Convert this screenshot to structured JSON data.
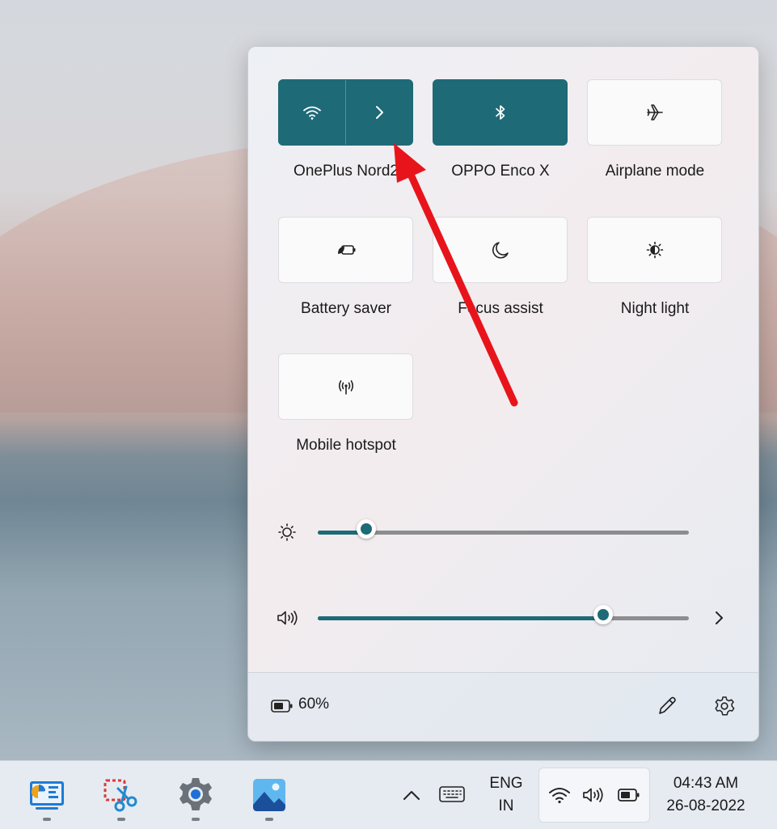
{
  "quick_settings": {
    "tiles": [
      {
        "label": "OnePlus Nord2",
        "icon": "wifi-icon",
        "state": "on",
        "has_expand": true
      },
      {
        "label": "OPPO Enco X",
        "icon": "bluetooth-icon",
        "state": "on"
      },
      {
        "label": "Airplane mode",
        "icon": "airplane-icon",
        "state": "off"
      },
      {
        "label": "Battery saver",
        "icon": "battery-saver-icon",
        "state": "off"
      },
      {
        "label": "Focus assist",
        "icon": "moon-icon",
        "state": "off"
      },
      {
        "label": "Night light",
        "icon": "night-light-icon",
        "state": "off"
      },
      {
        "label": "Mobile hotspot",
        "icon": "hotspot-icon",
        "state": "off"
      }
    ],
    "brightness": {
      "icon": "brightness-icon",
      "percent": 13
    },
    "volume": {
      "icon": "speaker-icon",
      "percent": 77
    },
    "battery": {
      "icon": "battery-icon",
      "text": "60%"
    },
    "edit_icon": "pencil-icon",
    "settings_icon": "gear-icon"
  },
  "taskbar": {
    "apps": [
      {
        "name": "dashboard-app-icon"
      },
      {
        "name": "snipping-tool-icon"
      },
      {
        "name": "settings-app-icon"
      },
      {
        "name": "photos-app-icon"
      }
    ],
    "language_line1": "ENG",
    "language_line2": "IN",
    "time": "04:43 AM",
    "date": "26-08-2022"
  },
  "colors": {
    "accent": "#1e6a77",
    "annotation_arrow": "#e8141c"
  }
}
